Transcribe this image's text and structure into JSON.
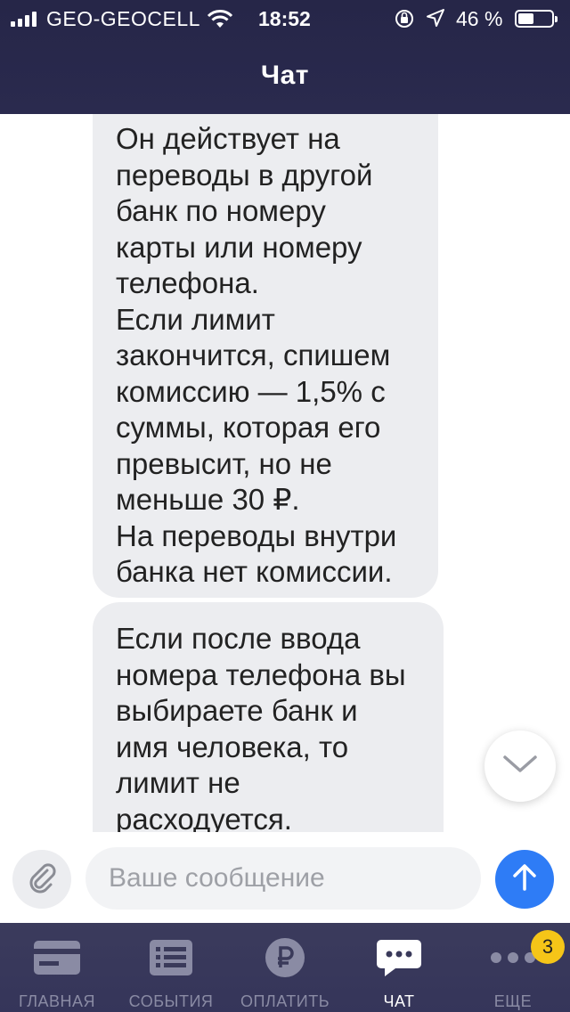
{
  "status_bar": {
    "carrier": "GEO-GEOCELL",
    "time": "18:52",
    "battery": "46 %",
    "battery_level": 0.46
  },
  "header": {
    "title": "Чат"
  },
  "messages": [
    {
      "text": "Он действует на\nпереводы в другой\nбанк по номеру\nкарты или номеру\nтелефона.\nЕсли лимит\nзакончится, спишем\nкомиссию — 1,5% с\nсуммы, которая его\nпревысит, но не\nменьше 30 ₽.\nНа переводы внутри\nбанка нет комиссии."
    },
    {
      "text": "Если после ввода\nномера телефона вы\nвыбираете банк и\nимя человека, то\nлимит не\nрасходуется."
    }
  ],
  "input": {
    "placeholder": "Ваше сообщение",
    "value": ""
  },
  "tabs": [
    {
      "label": "ГЛАВНАЯ",
      "icon": "card-icon"
    },
    {
      "label": "СОБЫТИЯ",
      "icon": "list-icon"
    },
    {
      "label": "ОПЛАТИТЬ",
      "icon": "ruble-icon"
    },
    {
      "label": "ЧАТ",
      "icon": "chat-icon",
      "active": true
    },
    {
      "label": "ЕЩЕ",
      "icon": "more-icon",
      "badge": "3"
    }
  ],
  "colors": {
    "header_bg": "#262649",
    "bubble_bg": "#ecedf0",
    "send_button": "#2e7cf6",
    "tabbar_bg": "#3a3a5a",
    "badge": "#f5c518"
  }
}
